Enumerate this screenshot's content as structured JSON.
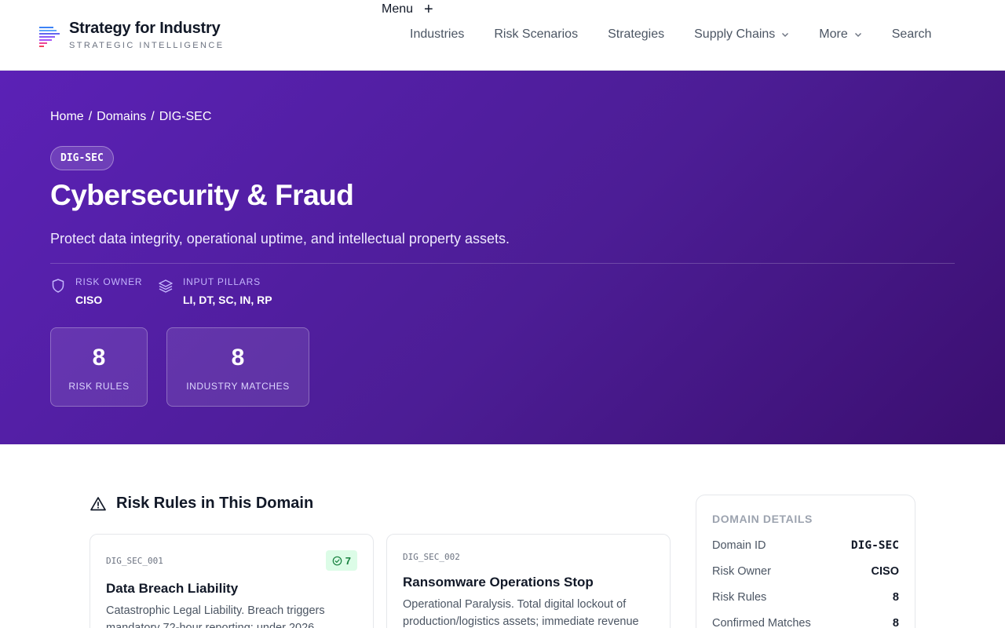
{
  "brand": {
    "name": "Strategy for Industry",
    "tagline": "STRATEGIC INTELLIGENCE"
  },
  "menu": {
    "label": "Menu",
    "plus": "+"
  },
  "nav": {
    "items": [
      {
        "label": "Industries"
      },
      {
        "label": "Risk Scenarios"
      },
      {
        "label": "Strategies"
      },
      {
        "label": "Supply Chains",
        "dropdown": true
      },
      {
        "label": "More",
        "dropdown": true
      },
      {
        "label": "Search"
      }
    ]
  },
  "hero": {
    "breadcrumb": [
      "Home",
      "/",
      "Domains",
      "/",
      "DIG-SEC"
    ],
    "code": "DIG-SEC",
    "title": "Cybersecurity & Fraud",
    "subtitle": "Protect data integrity, operational uptime, and intellectual property assets.",
    "meta": [
      {
        "label": "RISK OWNER",
        "value": "CISO",
        "icon": "shield-icon"
      },
      {
        "label": "INPUT PILLARS",
        "value": "LI, DT, SC, IN, RP",
        "icon": "layers-icon"
      }
    ],
    "stats": [
      {
        "value": "8",
        "label": "RISK RULES"
      },
      {
        "value": "8",
        "label": "INDUSTRY MATCHES"
      }
    ]
  },
  "rules_section": {
    "title": "Risk Rules in This Domain",
    "cards": [
      {
        "code": "DIG_SEC_001",
        "badge": "7",
        "title": "Data Breach Liability",
        "description": "Catastrophic Legal Liability. Breach triggers mandatory 72-hour reporting; under 2026"
      },
      {
        "code": "DIG_SEC_002",
        "title": "Ransomware Operations Stop",
        "description": "Operational Paralysis. Total digital lockout of production/logistics assets; immediate revenue"
      }
    ]
  },
  "domain_details": {
    "title": "DOMAIN DETAILS",
    "rows": [
      {
        "key": "Domain ID",
        "value": "DIG-SEC"
      },
      {
        "key": "Risk Owner",
        "value": "CISO"
      },
      {
        "key": "Risk Rules",
        "value": "8"
      },
      {
        "key": "Confirmed Matches",
        "value": "8"
      }
    ]
  },
  "colors": {
    "hero_gradient_start": "#5b21b6",
    "hero_gradient_end": "#3b0f70",
    "badge_bg": "#dcfce7",
    "badge_text": "#15803d"
  }
}
